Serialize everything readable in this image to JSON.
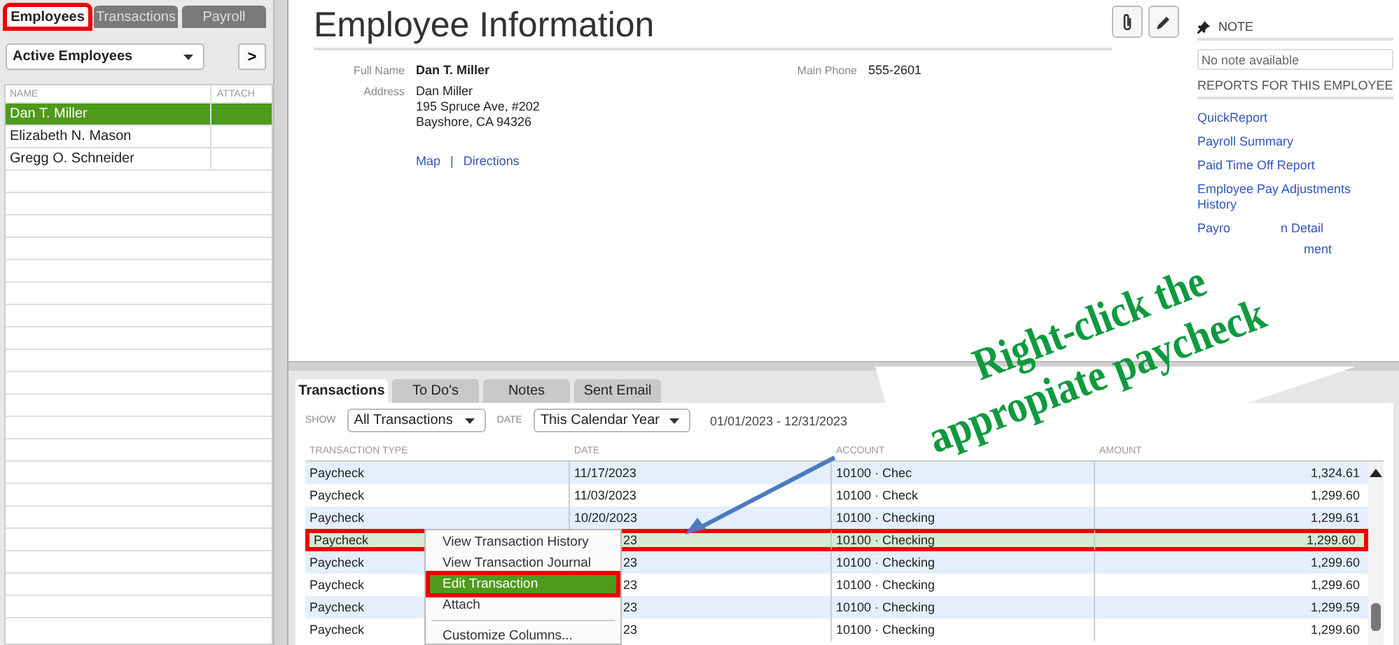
{
  "sidebar": {
    "tabs": [
      {
        "label": "Employees",
        "selected": true,
        "annotated": true
      },
      {
        "label": "Transactions",
        "selected": false,
        "annotated": false
      },
      {
        "label": "Payroll",
        "selected": false,
        "annotated": false
      }
    ],
    "filter": "Active Employees",
    "next_button": ">",
    "columns": [
      "NAME",
      "ATTACH"
    ],
    "employees": [
      {
        "name": "Dan T. Miller",
        "selected": true
      },
      {
        "name": "Elizabeth N. Mason",
        "selected": false
      },
      {
        "name": "Gregg O. Schneider",
        "selected": false
      }
    ]
  },
  "header": {
    "title": "Employee Information"
  },
  "info": {
    "full_name_label": "Full Name",
    "full_name": "Dan T. Miller",
    "address_label": "Address",
    "address": [
      "Dan Miller",
      "195 Spruce Ave, #202",
      "Bayshore, CA 94326"
    ],
    "phone_label": "Main Phone",
    "phone": "555-2601",
    "links": [
      "Map",
      "Directions"
    ],
    "link_separator": "|"
  },
  "note": {
    "title": "NOTE",
    "placeholder": "No note available",
    "reports_title": "REPORTS FOR THIS EMPLOYEE",
    "reports": [
      "QuickReport",
      "Payroll Summary",
      "Paid Time Off Report",
      "Employee Pay Adjustments History"
    ],
    "partial_reports": [
      [
        "Payro",
        "n Detail"
      ],
      [
        "ment"
      ]
    ]
  },
  "transactions": {
    "tabs": [
      {
        "label": "Transactions",
        "selected": true
      },
      {
        "label": "To Do's",
        "selected": false
      },
      {
        "label": "Notes",
        "selected": false
      },
      {
        "label": "Sent Email",
        "selected": false
      }
    ],
    "show_label": "SHOW",
    "show": "All Transactions",
    "date_label": "DATE",
    "date": "This Calendar Year",
    "range": "01/01/2023 - 12/31/2023",
    "columns": [
      "TRANSACTION TYPE",
      "DATE",
      "ACCOUNT",
      "AMOUNT"
    ],
    "rows": [
      {
        "type": "Paycheck",
        "date": "11/17/2023",
        "date_covered": false,
        "account": "10100 · Chec",
        "amount": "1,324.61",
        "selected": false,
        "annotated": false
      },
      {
        "type": "Paycheck",
        "date": "11/03/2023",
        "date_covered": false,
        "account": "10100 · Check",
        "amount": "1,299.60",
        "selected": false,
        "annotated": false
      },
      {
        "type": "Paycheck",
        "date": "10/20/2023",
        "date_covered": false,
        "account": "10100 · Checking",
        "amount": "1,299.61",
        "selected": false,
        "annotated": false
      },
      {
        "type": "Paycheck",
        "date": "23",
        "date_covered": true,
        "account": "10100 · Checking",
        "amount": "1,299.60",
        "selected": true,
        "annotated": true
      },
      {
        "type": "Paycheck",
        "date": "23",
        "date_covered": true,
        "account": "10100 · Checking",
        "amount": "1,299.60",
        "selected": false,
        "annotated": false
      },
      {
        "type": "Paycheck",
        "date": "23",
        "date_covered": true,
        "account": "10100 · Checking",
        "amount": "1,299.60",
        "selected": false,
        "annotated": false
      },
      {
        "type": "Paycheck",
        "date": "23",
        "date_covered": true,
        "account": "10100 · Checking",
        "amount": "1,299.59",
        "selected": false,
        "annotated": false
      },
      {
        "type": "Paycheck",
        "date": "23",
        "date_covered": true,
        "account": "10100 · Checking",
        "amount": "1,299.60",
        "selected": false,
        "annotated": false
      }
    ]
  },
  "context_menu": [
    {
      "kind": "item",
      "label": "View Transaction History",
      "hovered": false,
      "annotated": false
    },
    {
      "kind": "item",
      "label": "View Transaction Journal",
      "hovered": false,
      "annotated": false
    },
    {
      "kind": "item",
      "label": "Edit Transaction",
      "hovered": true,
      "annotated": true
    },
    {
      "kind": "item",
      "label": "Attach",
      "hovered": false,
      "annotated": false
    },
    {
      "kind": "separator"
    },
    {
      "kind": "item",
      "label": "Customize Columns...",
      "hovered": false,
      "annotated": false
    }
  ],
  "callout": {
    "lines": [
      "Right-click  the",
      "appropiate paycheck"
    ]
  }
}
